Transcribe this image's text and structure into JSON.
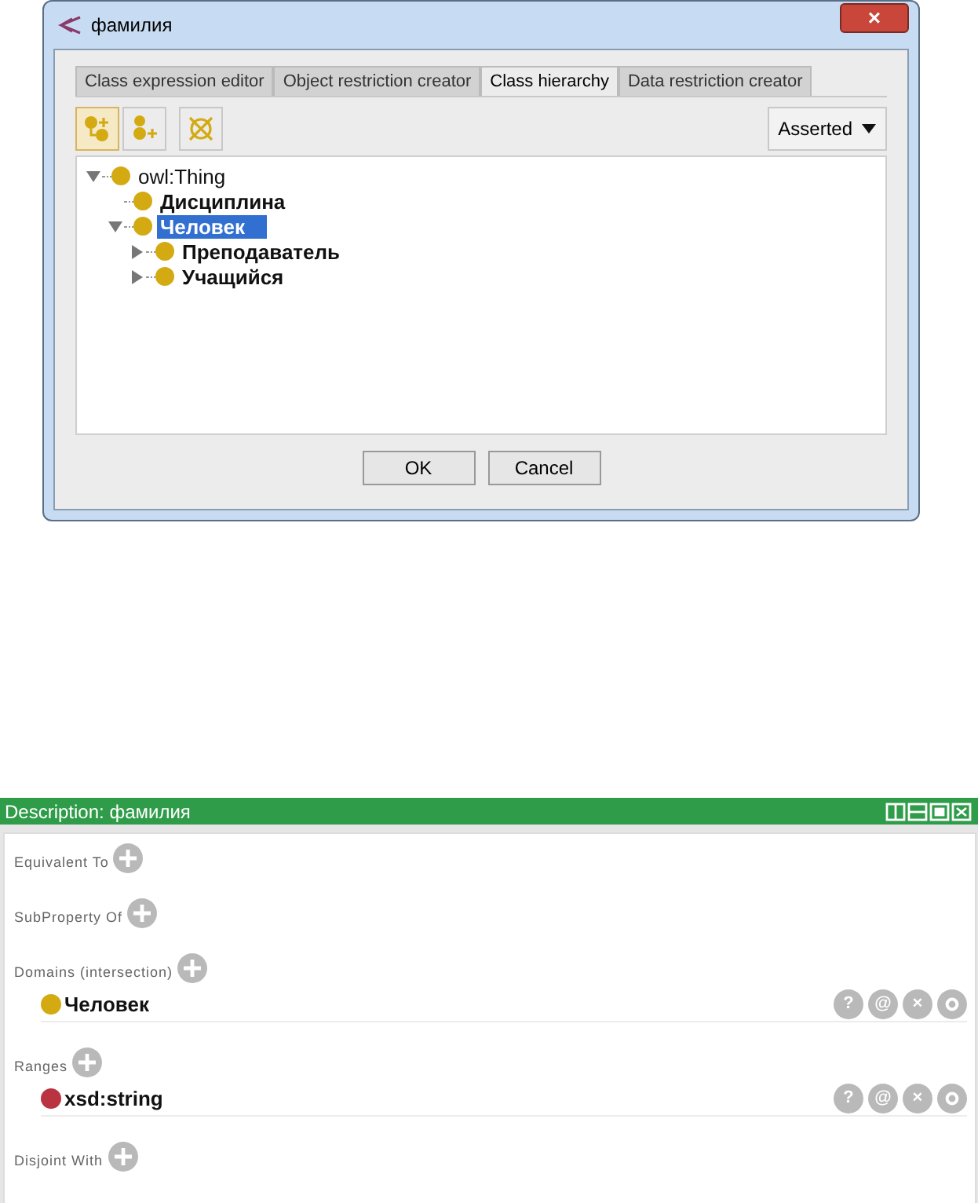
{
  "dialog": {
    "title": "фамилия",
    "close": "×",
    "tabs": [
      {
        "label": "Class expression editor",
        "selected": false
      },
      {
        "label": "Object restriction creator",
        "selected": false
      },
      {
        "label": "Class hierarchy",
        "selected": true
      },
      {
        "label": "Data restriction creator",
        "selected": false
      }
    ],
    "toolbar": [
      {
        "kind": "add-sub",
        "selected": true
      },
      {
        "kind": "add-sibling",
        "selected": false
      },
      {
        "kind": "delete",
        "selected": false
      }
    ],
    "mode": "Asserted",
    "tree": [
      {
        "label": "owl:Thing",
        "kind": "branch",
        "expanded": true,
        "selected": false,
        "children": [
          {
            "label": "Дисциплина",
            "kind": "leaf",
            "selected": false
          },
          {
            "label": "Человек",
            "kind": "branch",
            "expanded": true,
            "selected": true,
            "children": [
              {
                "label": "Преподаватель",
                "kind": "branch",
                "expanded": false,
                "selected": false
              },
              {
                "label": "Учащийся",
                "kind": "branch",
                "expanded": false,
                "selected": false
              }
            ]
          }
        ]
      }
    ],
    "buttons": [
      "OK",
      "Cancel"
    ]
  },
  "description": {
    "title": "Description: фамилия",
    "sections": [
      {
        "label": "Equivalent To"
      },
      {
        "label": "SubProperty Of"
      },
      {
        "label": "Domains (intersection)",
        "items": [
          {
            "name": "Человек",
            "color": "#d4aa12",
            "actions": [
              "?",
              "@",
              "×"
            ]
          }
        ]
      },
      {
        "label": "Ranges",
        "items": [
          {
            "name": "xsd:string",
            "color": "#b93440",
            "actions": [
              "?",
              "@",
              "×"
            ]
          }
        ]
      },
      {
        "label": "Disjoint With"
      }
    ]
  }
}
